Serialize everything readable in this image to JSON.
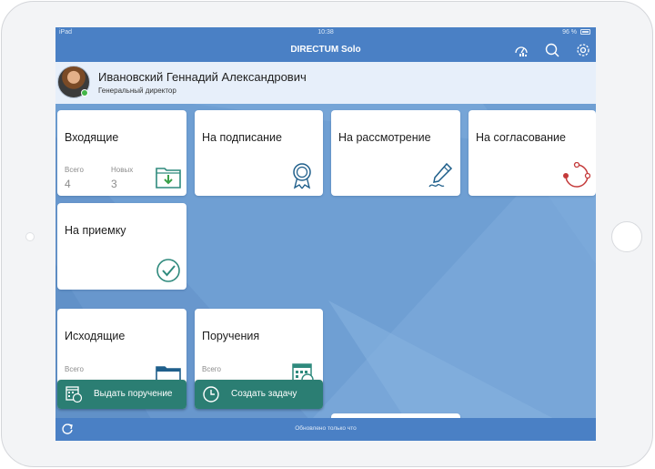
{
  "status_bar": {
    "carrier": "iPad",
    "time": "10:38",
    "battery": "96 %"
  },
  "nav": {
    "title": "DIRECTUM Solo",
    "icons": [
      "dashboard-icon",
      "search-icon",
      "gear-icon"
    ]
  },
  "profile": {
    "name": "Ивановский Геннадий Александрович",
    "role": "Генеральный директор",
    "status": "online"
  },
  "tiles": {
    "incoming": {
      "title": "Входящие",
      "total_label": "Всего",
      "total": "4",
      "new_label": "Новых",
      "new": "3",
      "icon": "inbox-download-icon"
    },
    "signing": {
      "title": "На подписание",
      "icon": "seal-ribbon-icon"
    },
    "review": {
      "title": "На рассмотрение",
      "icon": "pen-signature-icon"
    },
    "approval": {
      "title": "На согласование",
      "icon": "cycle-icon"
    },
    "acceptance": {
      "title": "На приемку",
      "icon": "check-circle-icon"
    },
    "outgoing": {
      "title": "Исходящие",
      "total_label": "Всего",
      "icon": "folder-upload-icon"
    },
    "assignments": {
      "title": "Поручения",
      "total_label": "Всего",
      "icon": "calendar-clock-icon"
    }
  },
  "actions": {
    "issue_assignment": "Выдать поручение",
    "create_task": "Создать задачу"
  },
  "footer": {
    "update_status": "Обновлено только что"
  },
  "colors": {
    "bar_blue": "#4a80c5",
    "background_blue": "#6f9fd3",
    "accent_teal": "#2b7e73",
    "online_green": "#43b649",
    "tile_white": "#ffffff"
  }
}
